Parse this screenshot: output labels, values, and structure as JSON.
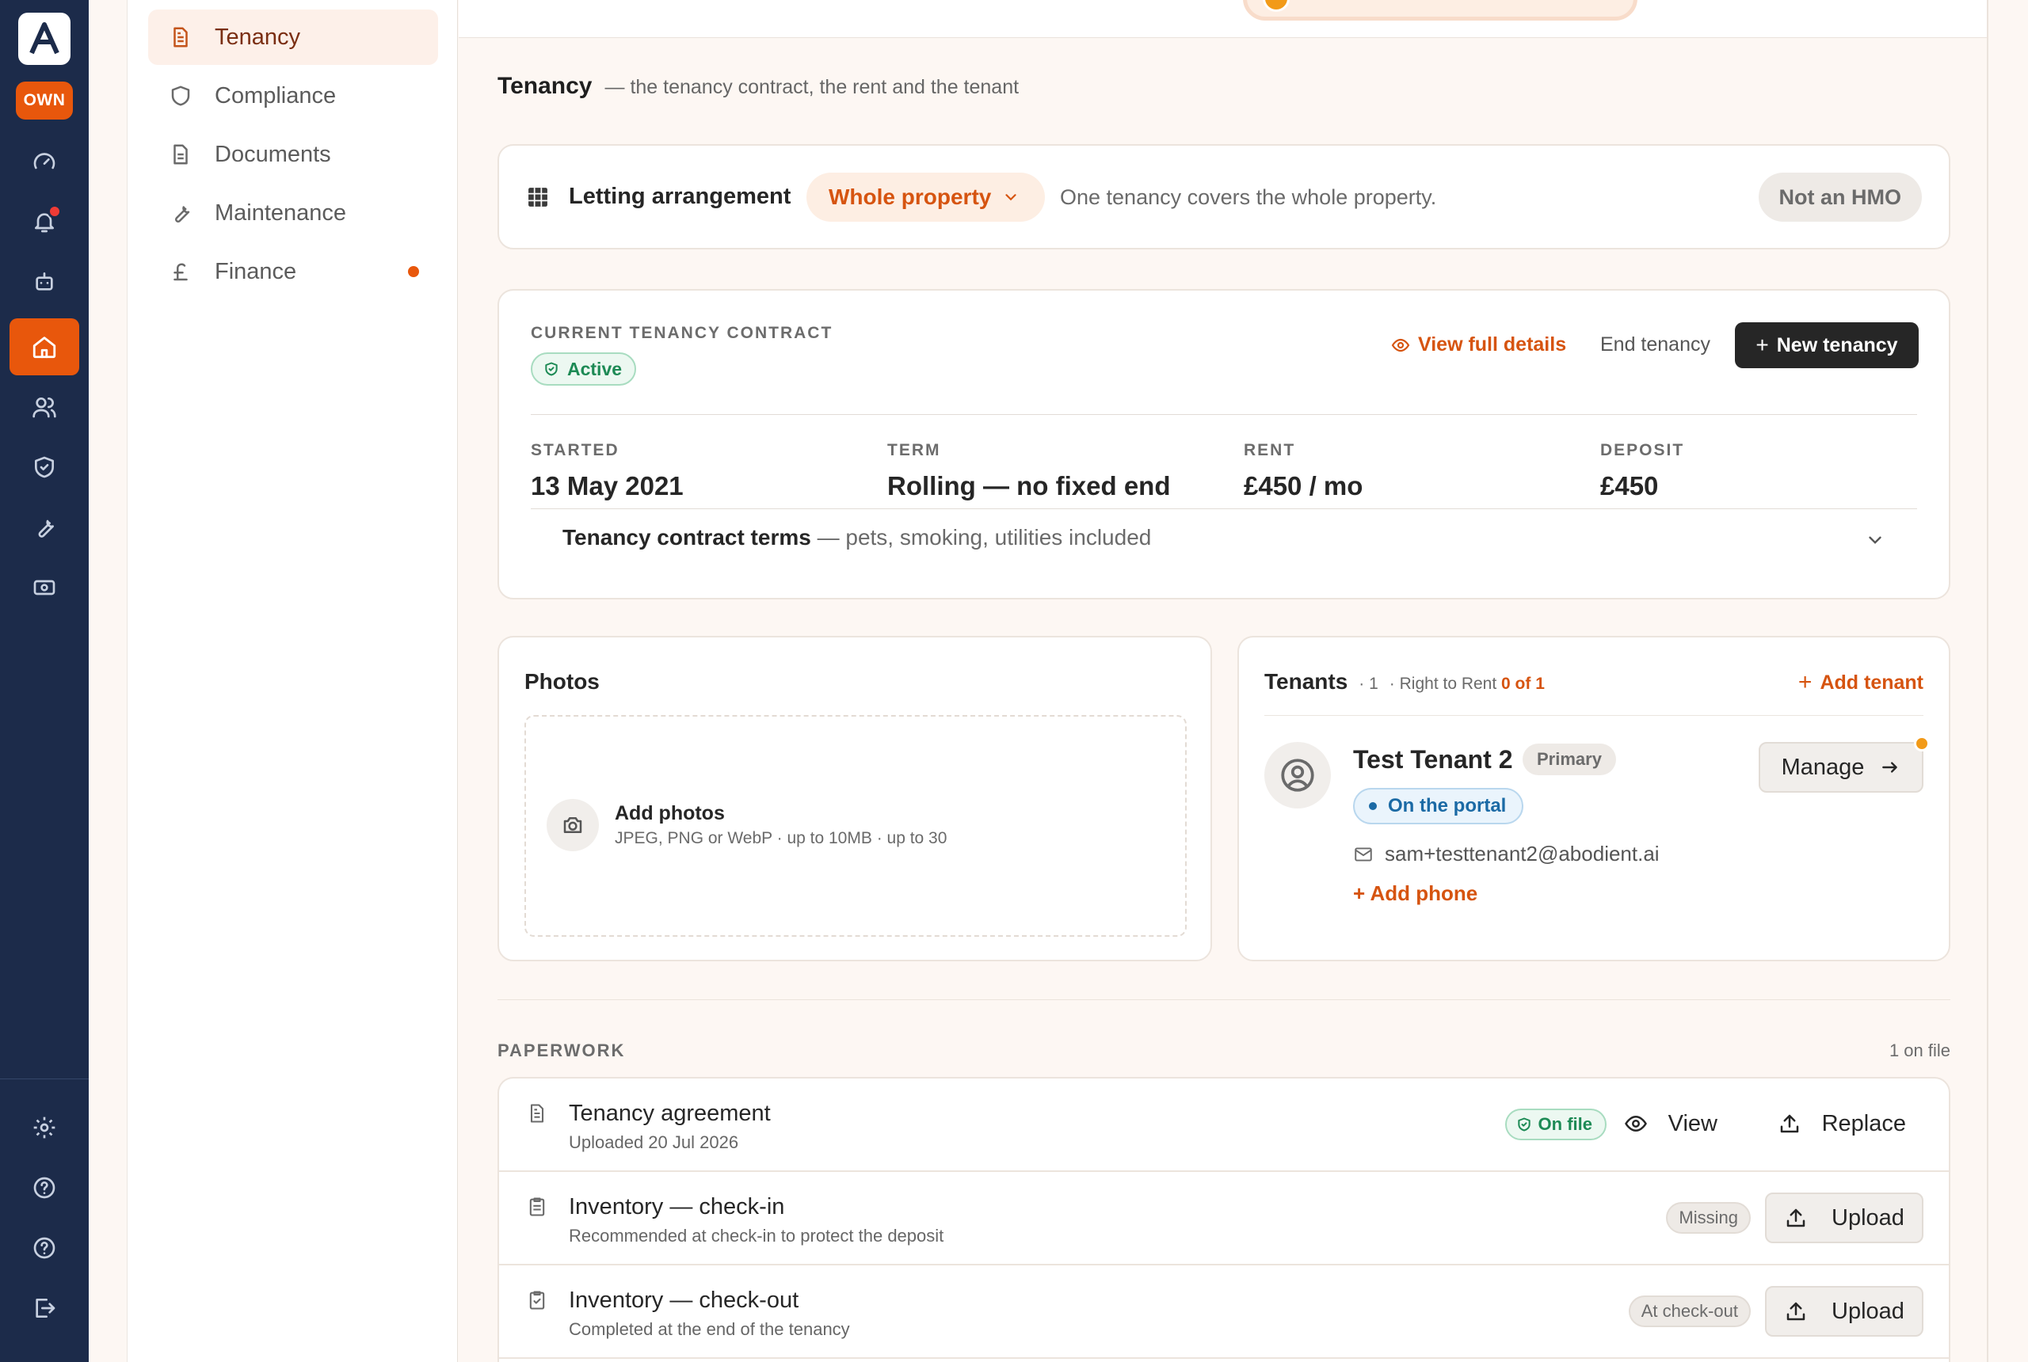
{
  "brand": {
    "logo_letter": "A",
    "mode_badge": "OWN"
  },
  "rail": {
    "items": [
      {
        "icon": "gauge-icon"
      },
      {
        "icon": "bell-icon",
        "has_notification": true
      },
      {
        "icon": "robot-icon"
      },
      {
        "icon": "home-icon",
        "active": true
      },
      {
        "icon": "users-icon"
      },
      {
        "icon": "shield-check-icon"
      },
      {
        "icon": "wrench-icon"
      },
      {
        "icon": "banknote-icon"
      }
    ],
    "bottom": [
      {
        "icon": "settings-icon"
      },
      {
        "icon": "help-circle-icon"
      },
      {
        "icon": "help-circle-icon"
      },
      {
        "icon": "logout-icon"
      }
    ]
  },
  "subnav": {
    "items": [
      {
        "label": "Tenancy",
        "icon": "file-text-icon",
        "active": true
      },
      {
        "label": "Compliance",
        "icon": "shield-icon"
      },
      {
        "label": "Documents",
        "icon": "document-icon"
      },
      {
        "label": "Maintenance",
        "icon": "wrench-icon"
      },
      {
        "label": "Finance",
        "icon": "pound-icon",
        "has_dot": true
      }
    ]
  },
  "section": {
    "title": "Tenancy",
    "subtitle": "— the tenancy contract, the rent and the tenant"
  },
  "letting": {
    "label": "Letting arrangement",
    "selected": "Whole property",
    "description": "One tenancy covers the whole property.",
    "hmo_badge": "Not an HMO"
  },
  "contract": {
    "caption": "CURRENT TENANCY CONTRACT",
    "status": "Active",
    "view_details": "View full details",
    "end_tenancy": "End tenancy",
    "new_tenancy": "New tenancy",
    "stats": {
      "started_label": "STARTED",
      "started_value": "13 May 2021",
      "term_label": "TERM",
      "term_value": "Rolling — no fixed end",
      "rent_label": "RENT",
      "rent_value": "£450 / mo",
      "deposit_label": "DEPOSIT",
      "deposit_value": "£450"
    },
    "terms_title": "Tenancy contract terms",
    "terms_desc": "— pets, smoking, utilities included"
  },
  "photos": {
    "title": "Photos",
    "add_title": "Add photos",
    "add_sub": "JPEG, PNG or WebP · up to 10MB · up to 30"
  },
  "tenants": {
    "title": "Tenants",
    "count": "· 1",
    "rtr_prefix": "· Right to Rent",
    "rtr_value": "0 of 1",
    "add_label": "Add tenant",
    "tenant": {
      "name": "Test Tenant 2",
      "role": "Primary",
      "portal": "On the portal",
      "email": "sam+testtenant2@abodient.ai",
      "add_phone": "+ Add phone"
    },
    "manage_label": "Manage"
  },
  "paperwork": {
    "caption": "PAPERWORK",
    "count": "1 on file",
    "rows": [
      {
        "title": "Tenancy agreement",
        "sub": "Uploaded 20 Jul 2026",
        "status": "On file",
        "view": "View",
        "replace": "Replace"
      },
      {
        "title": "Inventory — check-in",
        "sub": "Recommended at check-in to protect the deposit",
        "status": "Missing",
        "action": "Upload"
      },
      {
        "title": "Inventory — check-out",
        "sub": "Completed at the end of the tenancy",
        "status": "At check-out",
        "action": "Upload"
      }
    ]
  },
  "colors": {
    "rail_bg": "#1c2b4a",
    "accent": "#e8570c",
    "success": "#1d8a55",
    "info": "#1b6aa5"
  }
}
